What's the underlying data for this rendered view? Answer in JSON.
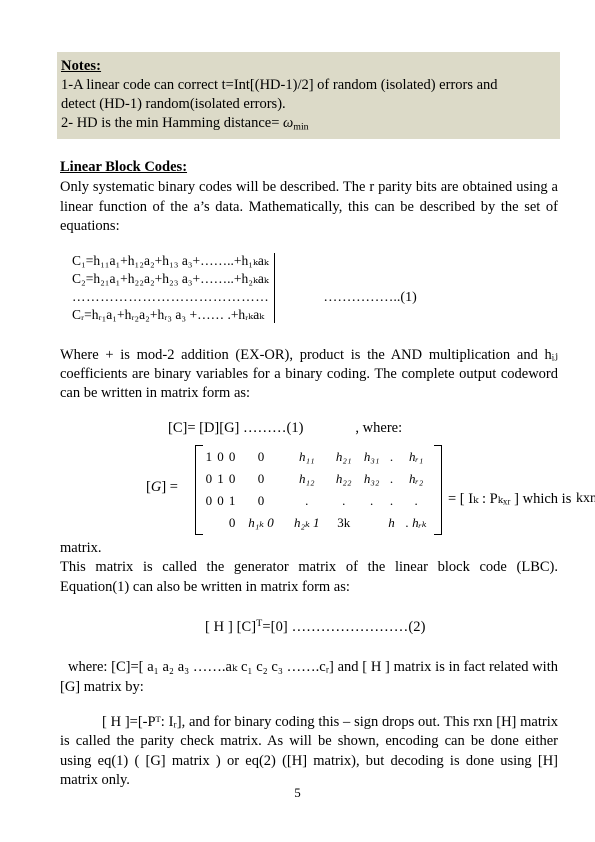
{
  "notes": {
    "title": "Notes:",
    "line1": "1-A linear code can correct t=Int[(HD-1)/2] of random (isolated) errors and",
    "line2": "detect (HD-1) random(isolated errors).",
    "line3_pre": "2- HD is the min Hamming distance= ",
    "line3_sym": "ω",
    "line3_sub": "min",
    "background": "#dcdac8"
  },
  "section": {
    "title": "Linear Block Codes:",
    "intro": "Only systematic binary codes will be described. The r parity bits are obtained using a linear function of the a’s data. Mathematically, this can be described by the set of equations:"
  },
  "equations": {
    "row1": "C₁=h₁₁a₁+h₁₂a₂+h₁₃ a₃+……..+h₁ₖaₖ",
    "row2": "C₂=h₂₁a₁+h₂₂a₂+h₂₃ a₃+……..+h₂ₖaₖ",
    "row3_dots": "……………………………………",
    "row4": "Cᵣ=hᵣ₁a₁+hᵣ₂a₂+hᵣ₃ a₃ +…… .+hᵣₖaₖ",
    "tag": "……………..(1)"
  },
  "para_where": "Where + is mod-2 addition (EX-OR), product is the AND multiplication and hᵢⱼ coefficients are binary variables for a binary coding. The complete output codeword can be written in matrix form as:",
  "matrix_eq_line": {
    "formula": "[C]= [D][G] ………(1)",
    "where_label": ", where:"
  },
  "gmatrix": {
    "label_open": "[",
    "label_g": "G",
    "label_close": "] =",
    "rows": [
      [
        "1",
        "0",
        "0",
        "0",
        "h₁₁",
        "h₂₁",
        "h₃₁",
        ".",
        "hᵣ₁"
      ],
      [
        "0",
        "1",
        "0",
        "0",
        "h₁₂",
        "h₂₂",
        "h₃₂",
        ".",
        "hᵣ₂"
      ],
      [
        "0",
        "0",
        "1",
        "0",
        ".",
        ".",
        ".",
        ".",
        "."
      ],
      [
        "",
        "",
        "0",
        "h₁ₖ 0",
        "h₂ₖ 1",
        "3k",
        "",
        "h",
        ". hᵣₖ"
      ]
    ],
    "rhs": "= [ Iₖ : Pₖₓᵣ ] which is",
    "dimension": "kxn"
  },
  "para_matrix_tail": "matrix.",
  "para_generator": "This matrix is called the generator matrix of the linear block code (LBC). Equation(1) can also be written in matrix form  as:",
  "eq2": {
    "formula_pre": "[ H ] [C]",
    "formula_sup": "T",
    "formula_post": "=[0] ……………………(2)"
  },
  "para_where2": "where:     [C]=[ a₁ a₂ a₃ …….aₖ c₁ c₂ c₃ …….cᵣ] and [ H ] matrix is in fact related with [G] matrix by:",
  "para_parity": "[ H ]=[-Pᵀ: Iᵣ], and for binary coding this – sign drops out. This rxn [H] matrix is called the parity check matrix. As will be shown, encoding can be done either using eq(1) ( [G] matrix ) or eq(2) ([H] matrix), but decoding is done using [H] matrix only.",
  "page_number": "5"
}
